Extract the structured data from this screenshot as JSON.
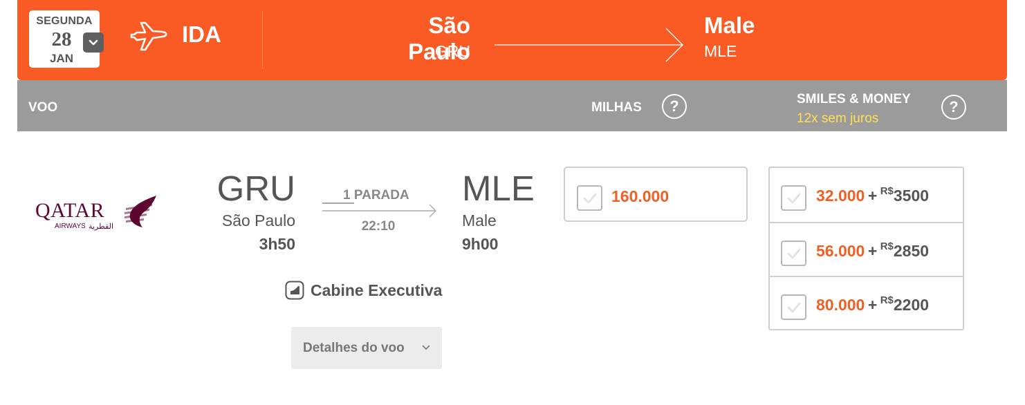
{
  "header": {
    "date": {
      "weekday": "SEGUNDA",
      "day": "28",
      "month": "JAN"
    },
    "direction_label": "IDA",
    "origin": {
      "city": "São Paulo",
      "code": "GRU"
    },
    "destination": {
      "city": "Male",
      "code": "MLE"
    },
    "icons": {
      "date_toggle": "chevron-down-icon",
      "plane": "plane-icon",
      "route": "arrow-right-icon"
    },
    "colors": {
      "background": "#fa5a23",
      "text": "#ffffff"
    }
  },
  "columns": {
    "flight": "VOO",
    "miles": "MILHAS",
    "miles_help": "?",
    "smiles_money": "SMILES & MONEY",
    "installments": "12x sem juros",
    "smiles_money_help": "?",
    "colors": {
      "background": "#9b9b9b",
      "installments": "#ffe14f"
    }
  },
  "flight": {
    "airline": {
      "name": "QATAR",
      "subtitle": "AIRWAYS",
      "arabic": "القطرية"
    },
    "origin": {
      "code": "GRU",
      "city": "São Paulo",
      "time": "3h50"
    },
    "stops": "1 PARADA",
    "duration": "22:10",
    "destination": {
      "code": "MLE",
      "city": "Male",
      "time": "9h00"
    },
    "cabin": "Cabine Executiva",
    "details_button": "Detalhes do voo"
  },
  "prices": {
    "miles_only": {
      "miles": "160.000"
    },
    "smiles_money": [
      {
        "miles": "32.000",
        "plus": "+",
        "currency": "R$",
        "amount": "3500"
      },
      {
        "miles": "56.000",
        "plus": "+",
        "currency": "R$",
        "amount": "2850"
      },
      {
        "miles": "80.000",
        "plus": "+",
        "currency": "R$",
        "amount": "2200"
      }
    ],
    "colors": {
      "miles": "#f05f24",
      "checkbox_border": "#b7b7b7"
    }
  }
}
